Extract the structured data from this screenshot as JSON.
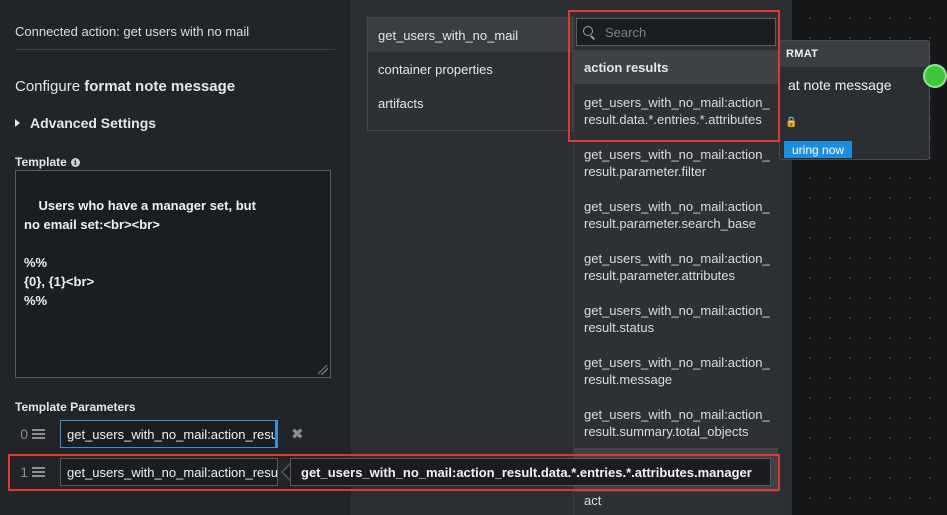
{
  "left_panel": {
    "connected_action": "Connected action: get users with no mail",
    "configure_prefix": "Configure",
    "configure_target": "format note message",
    "advanced_settings": "Advanced Settings",
    "template_label": "Template",
    "template_text": "Users who have a manager set, but\nno email set:<br><br>\n\n%%\n{0}, {1}<br>\n%%",
    "params_label": "Template Parameters",
    "params": [
      {
        "index": "0",
        "value": "get_users_with_no_mail:action_result.data.*.entries.*.attributes"
      },
      {
        "index": "1",
        "value": "get_users_with_no_mail:action_result.data.*.entries.*.attributes.manager"
      }
    ],
    "tooltip": "get_users_with_no_mail:action_result.data.*.entries.*.attributes.manager"
  },
  "source_list": {
    "items": [
      "get_users_with_no_mail",
      "container properties",
      "artifacts"
    ],
    "selected_index": 0
  },
  "dropdown": {
    "search_placeholder": "Search",
    "header": "action results",
    "items": [
      {
        "line1": "get_users_with_no_mail:action_",
        "line2": "result.data.*.entries.*.attributes"
      },
      {
        "line1": "get_users_with_no_mail:action_",
        "line2": "result.parameter.filter"
      },
      {
        "line1": "get_users_with_no_mail:action_",
        "line2": "result.parameter.search_base"
      },
      {
        "line1": "get_users_with_no_mail:action_",
        "line2": "result.parameter.attributes"
      },
      {
        "line1": "get_users_with_no_mail:action_",
        "line2": "result.status"
      },
      {
        "line1": "get_users_with_no_mail:action_",
        "line2": "result.message"
      },
      {
        "line1": "get_users_with_no_mail:action_",
        "line2": "result.summary.total_objects"
      }
    ],
    "last_item": "act"
  },
  "canvas_node": {
    "header": "RMAT",
    "title": "at note message",
    "badge": "uring now"
  },
  "colors": {
    "highlight": "#e03a2e",
    "accent": "#1b8ee0",
    "port": "#3ec63e"
  }
}
